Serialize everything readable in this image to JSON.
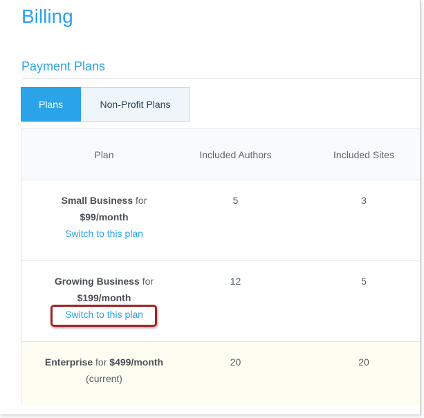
{
  "page": {
    "title": "Billing",
    "section_title": "Payment Plans"
  },
  "tabs": [
    {
      "label": "Plans",
      "active": true
    },
    {
      "label": "Non-Profit Plans",
      "active": false
    }
  ],
  "table": {
    "headers": {
      "plan": "Plan",
      "authors": "Included Authors",
      "sites": "Included Sites"
    },
    "rows": [
      {
        "name": "Small Business",
        "for_text": " for",
        "price": "$99/month",
        "action": "Switch to this plan",
        "authors": "5",
        "sites": "3"
      },
      {
        "name": "Growing Business",
        "for_text": " for",
        "price": "$199/month",
        "action": "Switch to this plan",
        "authors": "12",
        "sites": "5"
      },
      {
        "name": "Enterprise",
        "for_text": " for ",
        "price": "$499/month",
        "status": "(current)",
        "authors": "20",
        "sites": "20"
      }
    ]
  },
  "colors": {
    "accent": "#2aa3e8",
    "current_row_bg": "#fdfdf1",
    "highlight_outline": "#a32124"
  }
}
